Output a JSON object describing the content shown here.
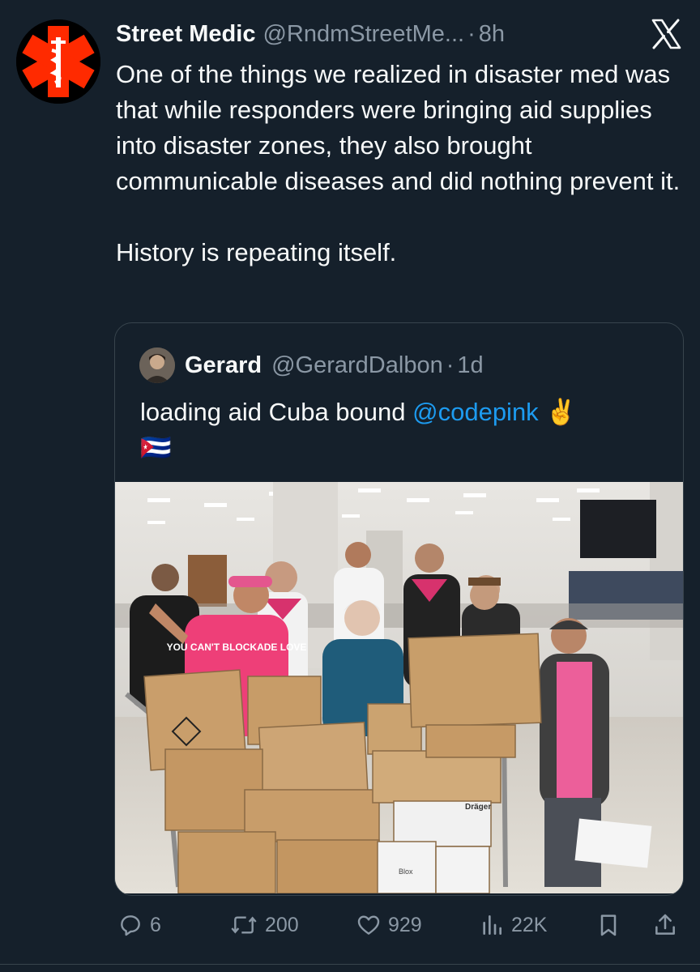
{
  "tweet": {
    "author_name": "Street Medic",
    "author_handle": "@RndmStreetMe...",
    "separator": "·",
    "time": "8h",
    "text": "One of the things we realized in disaster med was that while responders were bringing aid supplies into disaster zones, they also brought communicable diseases and did nothing prevent it.\n\nHistory is repeating itself.",
    "avatar_icon": "star-of-life-icon"
  },
  "quoted": {
    "author_name": "Gerard",
    "author_handle": "@GerardDalbon",
    "separator": "·",
    "time": "1d",
    "text_before": "loading aid Cuba bound ",
    "mention": "@codepink",
    "text_after": " ✌️",
    "flag_emoji": "🇨🇺",
    "photo_description_icon": "photo",
    "box_labels": {
      "shirt": "YOU CAN'T BLOCKADE LOVE",
      "blox": "Blox",
      "draeger": "Dräger"
    }
  },
  "actions": {
    "reply_count": "6",
    "repost_count": "200",
    "like_count": "929",
    "view_count": "22K"
  },
  "colors": {
    "background": "#15202b",
    "text": "#f7f9f9",
    "secondary": "#8b98a5",
    "link": "#1d9bf0",
    "border": "#38444d",
    "avatar_red": "#ff2a00"
  }
}
